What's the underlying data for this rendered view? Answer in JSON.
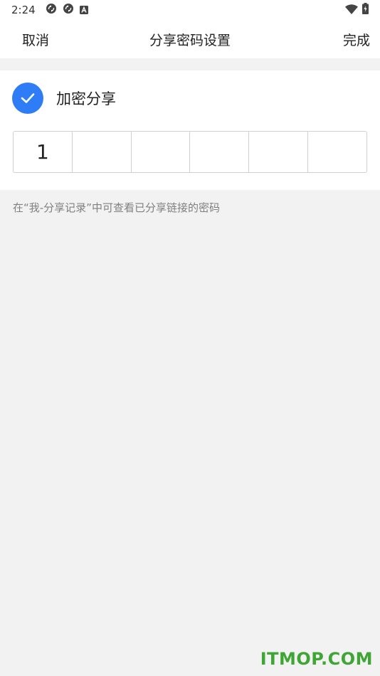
{
  "status_bar": {
    "time": "2:24",
    "icons": [
      "sync-icon",
      "sync-icon",
      "a-box-icon",
      "wifi-icon",
      "battery-charging-icon"
    ]
  },
  "nav": {
    "cancel_label": "取消",
    "title": "分享密码设置",
    "done_label": "完成"
  },
  "encrypt": {
    "label": "加密分享",
    "checked": true,
    "accent_color": "#2f7df6"
  },
  "pin": {
    "digits": [
      "1",
      "",
      "",
      "",
      "",
      ""
    ]
  },
  "hint": "在“我-分享记录”中可查看已分享链接的密码",
  "watermark": "ITMOP.COM"
}
